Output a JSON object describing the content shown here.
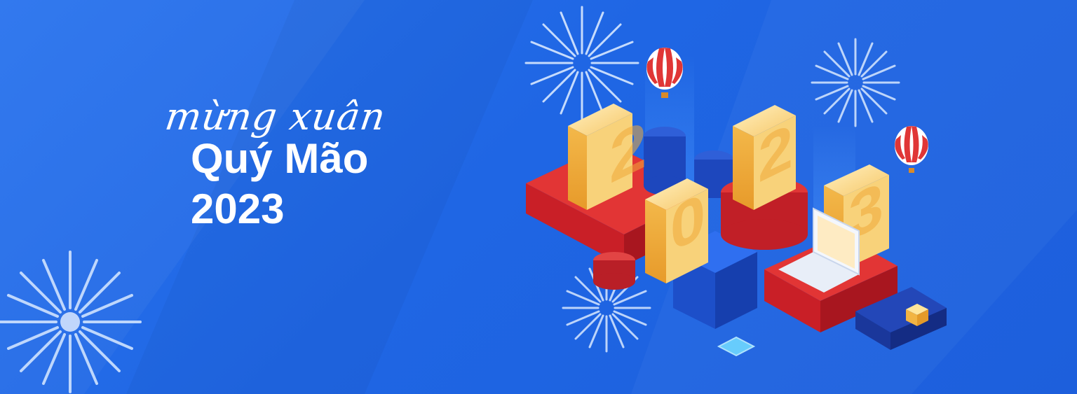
{
  "banner": {
    "script_line": "mừng xuân",
    "title": "Quý Mão",
    "year": "2023"
  },
  "illustration": {
    "digits": [
      "2",
      "0",
      "2",
      "3"
    ],
    "icons": [
      "firework-icon",
      "hot-air-balloon-icon",
      "laptop-icon",
      "cube-icon"
    ]
  },
  "colors": {
    "background": "#1f6ae6",
    "gold": "#f6c85f",
    "red": "#e02b2b",
    "navy": "#1b3fb0",
    "white": "#ffffff"
  }
}
